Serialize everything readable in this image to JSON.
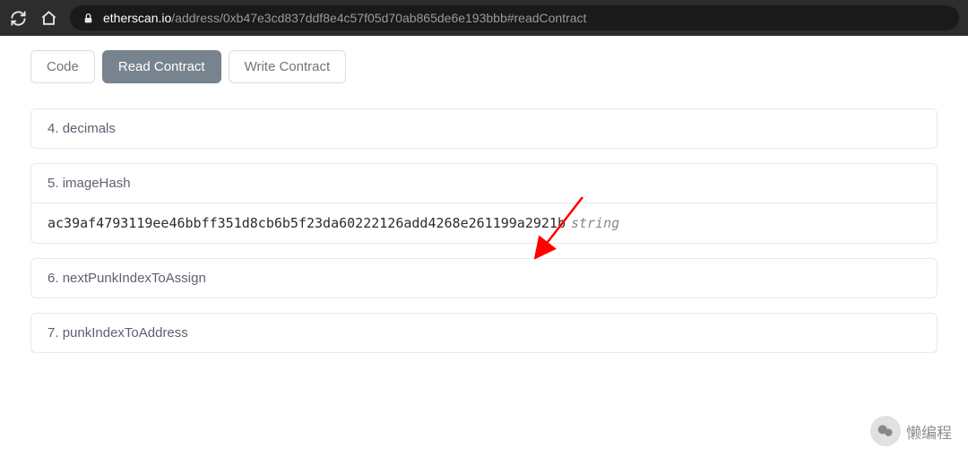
{
  "url": {
    "domain": "etherscan.io",
    "path": "/address/0xb47e3cd837ddf8e4c57f05d70ab865de6e193bbb#readContract"
  },
  "tabs": {
    "code": "Code",
    "read": "Read Contract",
    "write": "Write Contract"
  },
  "rows": {
    "r4": {
      "num": "4.",
      "name": "decimals"
    },
    "r5": {
      "num": "5.",
      "name": "imageHash",
      "value": "ac39af4793119ee46bbff351d8cb6b5f23da60222126add4268e261199a2921b",
      "type": "string"
    },
    "r6": {
      "num": "6.",
      "name": "nextPunkIndexToAssign"
    },
    "r7": {
      "num": "7.",
      "name": "punkIndexToAddress"
    }
  },
  "watermark": "懒编程"
}
